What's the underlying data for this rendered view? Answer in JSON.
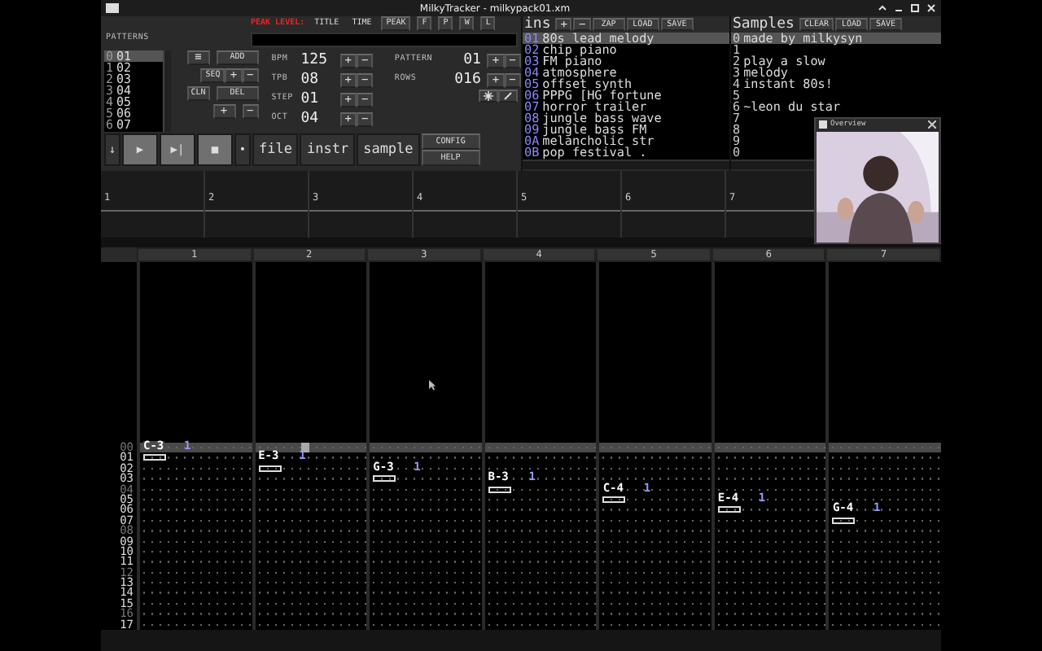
{
  "window": {
    "title": "MilkyTracker - milkypack01.xm"
  },
  "peak": {
    "label": "PEAK LEVEL:",
    "tabs": [
      {
        "label": "TITLE",
        "selected": false
      },
      {
        "label": "TIME",
        "selected": false
      }
    ],
    "buttons": [
      "PEAK",
      "F",
      "P",
      "W",
      "L"
    ]
  },
  "patterns": {
    "label": "PATTERNS",
    "items": [
      {
        "index": "0",
        "pattern": "01",
        "selected": true
      },
      {
        "index": "1",
        "pattern": "02",
        "selected": false
      },
      {
        "index": "2",
        "pattern": "03",
        "selected": false
      },
      {
        "index": "3",
        "pattern": "04",
        "selected": false
      },
      {
        "index": "4",
        "pattern": "05",
        "selected": false
      },
      {
        "index": "5",
        "pattern": "06",
        "selected": false
      },
      {
        "index": "6",
        "pattern": "07",
        "selected": false
      }
    ],
    "buttons": [
      [
        "≡",
        "ADD"
      ],
      [
        "SEQ",
        "+",
        "−"
      ],
      [
        "CLN",
        "DEL"
      ],
      [
        "+",
        "−"
      ]
    ]
  },
  "settings": [
    {
      "label": "BPM",
      "value": "125",
      "buttons": [
        "+",
        "−"
      ]
    },
    {
      "label": "TPB",
      "value": "08",
      "buttons": [
        "+",
        "−"
      ]
    },
    {
      "label": "STEP",
      "value": "01",
      "buttons": [
        "+",
        "−"
      ]
    },
    {
      "label": "OCT",
      "value": "04",
      "buttons": [
        "+",
        "−"
      ]
    }
  ],
  "pattern_info": [
    {
      "label": "PATTERN",
      "value": "01",
      "buttons": [
        "+",
        "−"
      ]
    },
    {
      "label": "ROWS",
      "value": "016",
      "buttons": [
        "+",
        "−"
      ]
    }
  ],
  "transport": [
    {
      "label": "↓",
      "kind": "small"
    },
    {
      "label": "▶",
      "kind": "play"
    },
    {
      "label": "▶|",
      "kind": "play"
    },
    {
      "label": "■",
      "kind": "play"
    },
    {
      "label": "•",
      "kind": "small"
    },
    {
      "label": "file",
      "kind": "large"
    },
    {
      "label": "instr",
      "kind": "large"
    },
    {
      "label": "sample",
      "kind": "large"
    }
  ],
  "config_buttons": [
    "CONFIG",
    "HELP"
  ],
  "instruments": {
    "title": "ins",
    "buttons": [
      "+",
      "−",
      "ZAP",
      "LOAD",
      "SAVE"
    ],
    "items": [
      {
        "index": "01",
        "name": "80s lead melody",
        "selected": true
      },
      {
        "index": "02",
        "name": "chip piano",
        "selected": false
      },
      {
        "index": "03",
        "name": "FM piano",
        "selected": false
      },
      {
        "index": "04",
        "name": "atmosphere",
        "selected": false
      },
      {
        "index": "05",
        "name": "offset synth",
        "selected": false
      },
      {
        "index": "06",
        "name": "PPPG [HG fortune",
        "selected": false
      },
      {
        "index": "07",
        "name": "horror trailer",
        "selected": false
      },
      {
        "index": "08",
        "name": "jungle bass wave",
        "selected": false
      },
      {
        "index": "09",
        "name": "jungle bass FM",
        "selected": false
      },
      {
        "index": "0A",
        "name": "melancholic str",
        "selected": false
      },
      {
        "index": "0B",
        "name": "pop festival .",
        "selected": false
      }
    ]
  },
  "samples": {
    "title": "Samples",
    "buttons": [
      "CLEAR",
      "LOAD",
      "SAVE"
    ],
    "items": [
      {
        "index": "0",
        "name": "made by milkysyn",
        "selected": true
      },
      {
        "index": "1",
        "selected": false
      },
      {
        "index": "2",
        "name": "play a slow",
        "selected": false
      },
      {
        "index": "3",
        "name": "melody",
        "selected": false
      },
      {
        "index": "4",
        "name": "instant 80s!",
        "selected": false
      },
      {
        "index": "5",
        "selected": false
      },
      {
        "index": "6",
        "name": "~leon du star",
        "selected": false
      },
      {
        "index": "7",
        "selected": false
      },
      {
        "index": "8",
        "selected": false
      },
      {
        "index": "9",
        "selected": false
      },
      {
        "index": "0",
        "selected": false
      }
    ]
  },
  "scopes": [
    "1",
    "2",
    "3",
    "4",
    "5",
    "6",
    "7"
  ],
  "webcam": {
    "title": "Overview",
    "kind": "picture"
  },
  "pattern": {
    "channels": [
      "1",
      "2",
      "3",
      "4",
      "5",
      "6",
      "7"
    ],
    "rows": [
      {
        "label": "00",
        "selected": true,
        "beat": true,
        "cells": [
          {
            "note": "C-3",
            "instrument": "1"
          },
          {
            "cursor": true
          },
          {},
          {},
          {},
          {},
          {}
        ]
      },
      {
        "label": "01",
        "selected": false,
        "beat": false,
        "cells": [
          {
            "box": true
          },
          {
            "note": "E-3",
            "instrument": "1"
          },
          {},
          {},
          {},
          {},
          {}
        ]
      },
      {
        "label": "02",
        "selected": false,
        "beat": false,
        "cells": [
          {},
          {
            "box": true
          },
          {
            "note": "G-3",
            "instrument": "1"
          },
          {},
          {},
          {},
          {}
        ]
      },
      {
        "label": "03",
        "selected": false,
        "beat": false,
        "cells": [
          {},
          {},
          {
            "box": true
          },
          {
            "note": "B-3",
            "instrument": "1"
          },
          {},
          {},
          {}
        ]
      },
      {
        "label": "04",
        "selected": false,
        "beat": true,
        "cells": [
          {},
          {},
          {},
          {
            "box": true
          },
          {
            "note": "C-4",
            "instrument": "1"
          },
          {},
          {}
        ]
      },
      {
        "label": "05",
        "selected": false,
        "beat": false,
        "cells": [
          {},
          {},
          {},
          {},
          {
            "box": true
          },
          {
            "note": "E-4",
            "instrument": "1"
          },
          {}
        ]
      },
      {
        "label": "06",
        "selected": false,
        "beat": false,
        "cells": [
          {},
          {},
          {},
          {},
          {},
          {
            "box": true
          },
          {
            "note": "G-4",
            "instrument": "1"
          }
        ]
      },
      {
        "label": "07",
        "selected": false,
        "beat": false,
        "cells": [
          {},
          {},
          {},
          {},
          {},
          {},
          {
            "box": true
          }
        ]
      },
      {
        "label": "08",
        "selected": false,
        "beat": true,
        "cells": [
          {},
          {},
          {},
          {},
          {},
          {},
          {}
        ]
      },
      {
        "label": "09",
        "selected": false,
        "beat": false,
        "cells": [
          {},
          {},
          {},
          {},
          {},
          {},
          {}
        ]
      },
      {
        "label": "10",
        "selected": false,
        "beat": false,
        "cells": [
          {},
          {},
          {},
          {},
          {},
          {},
          {}
        ]
      },
      {
        "label": "11",
        "selected": false,
        "beat": false,
        "cells": [
          {},
          {},
          {},
          {},
          {},
          {},
          {}
        ]
      },
      {
        "label": "12",
        "selected": false,
        "beat": true,
        "cells": [
          {},
          {},
          {},
          {},
          {},
          {},
          {}
        ]
      },
      {
        "label": "13",
        "selected": false,
        "beat": false,
        "cells": [
          {},
          {},
          {},
          {},
          {},
          {},
          {}
        ]
      },
      {
        "label": "14",
        "selected": false,
        "beat": false,
        "cells": [
          {},
          {},
          {},
          {},
          {},
          {},
          {}
        ]
      },
      {
        "label": "15",
        "selected": false,
        "beat": false,
        "cells": [
          {},
          {},
          {},
          {},
          {},
          {},
          {}
        ]
      },
      {
        "label": "16",
        "selected": false,
        "beat": true,
        "cells": [
          {},
          {},
          {},
          {},
          {},
          {},
          {}
        ]
      },
      {
        "label": "17",
        "selected": false,
        "beat": false,
        "cells": [
          {},
          {},
          {},
          {},
          {},
          {},
          {}
        ]
      }
    ]
  }
}
